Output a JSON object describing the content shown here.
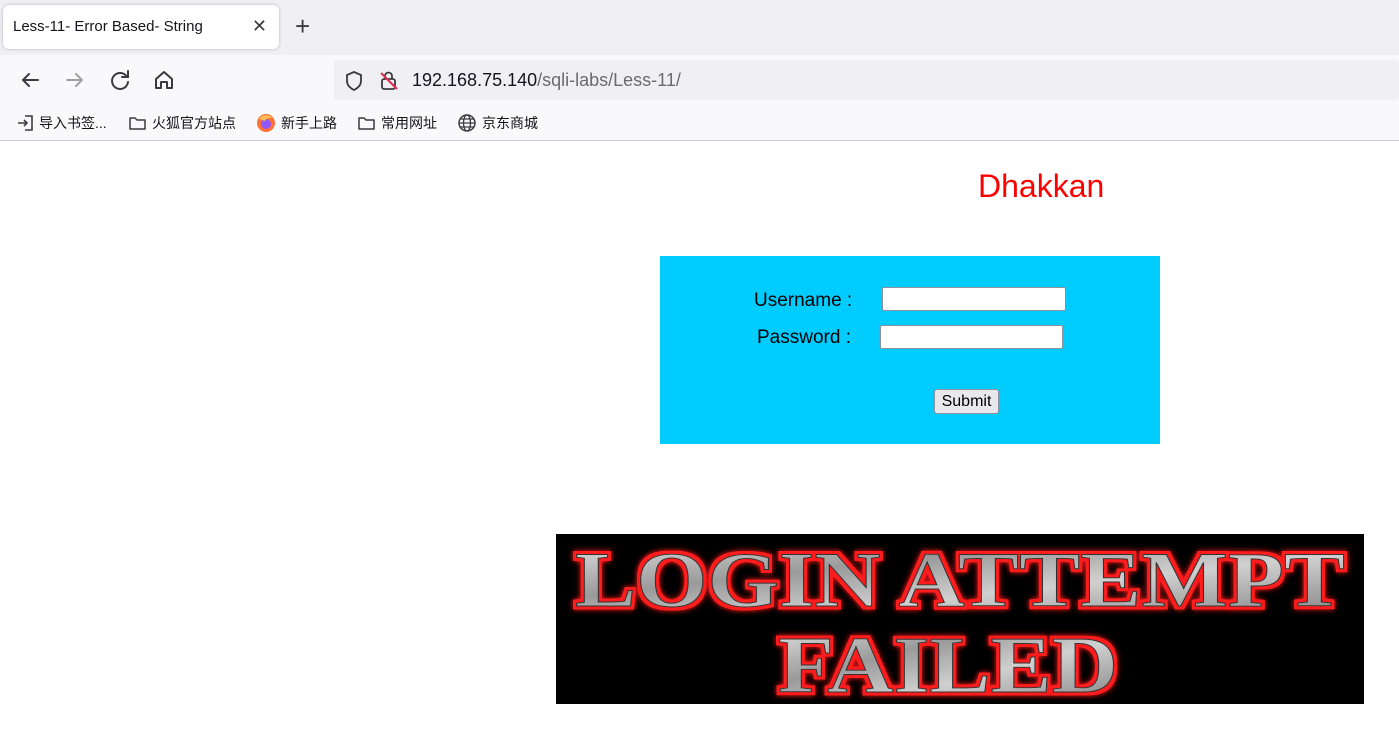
{
  "browser": {
    "tab_title": "Less-11- Error Based- String",
    "tab_close": "✕",
    "new_tab": "+",
    "url_host": "192.168.75.140",
    "url_path": "/sqli-labs/Less-11/"
  },
  "bookmarks": [
    {
      "label": "导入书签...",
      "icon": "import-icon"
    },
    {
      "label": "火狐官方站点",
      "icon": "folder-icon"
    },
    {
      "label": "新手上路",
      "icon": "firefox-icon"
    },
    {
      "label": "常用网址",
      "icon": "folder-icon"
    },
    {
      "label": "京东商城",
      "icon": "globe-icon"
    }
  ],
  "page": {
    "brand": "Dhakkan",
    "username_label": "Username :",
    "password_label": "Password :",
    "submit_label": "Submit",
    "banner_line1": "LOGIN ATTEMPT",
    "banner_line2": "FAILED"
  },
  "colors": {
    "brand": "#ff0000",
    "login_box": "#00ccff",
    "banner_bg": "#000000",
    "banner_glow": "#ff0000"
  }
}
